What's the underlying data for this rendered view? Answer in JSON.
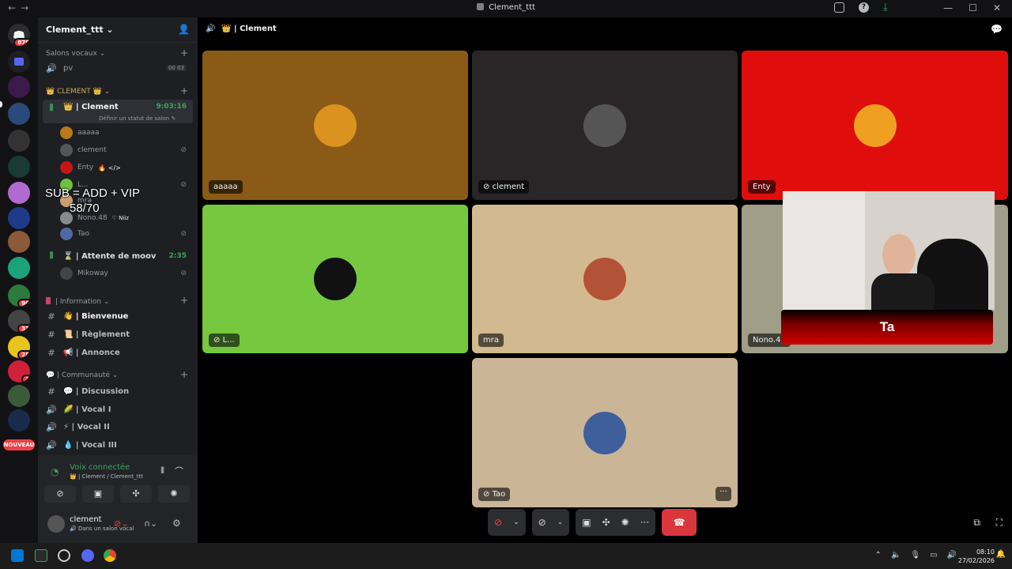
{
  "window": {
    "title": "Clement_ttt",
    "nav_back": "←",
    "nav_fwd": "→",
    "help": "?",
    "download": "⤓",
    "min": "—",
    "max": "☐",
    "close": "✕"
  },
  "rail": {
    "badges": {
      "home": "879",
      "s12": "90",
      "s13": "33",
      "s14": "28",
      "s15": "3",
      "new": "NOUVEAU"
    }
  },
  "guild": {
    "name": "Clement_ttt ⌄"
  },
  "sidebar": {
    "voice_category": "Salons vocaux ⌄",
    "pv": {
      "name": "pv",
      "counts": "00 03"
    },
    "clement_category": "👑 CLEMENT 👑 ⌄",
    "clement_channel": {
      "name": "👑 | Clement",
      "timer": "9:03:16",
      "status": "Définir un statut de salon ✎"
    },
    "users": [
      {
        "name": "aaaaa",
        "muted": false,
        "color": "#b87a1a"
      },
      {
        "name": "clement",
        "muted": true,
        "color": "#555"
      },
      {
        "name": "Enty",
        "tag": "🔥 </>",
        "muted": false,
        "color": "#c41818"
      },
      {
        "name": "L...",
        "muted": true,
        "color": "#6fbf3f"
      },
      {
        "name": "mra",
        "muted": false,
        "color": "#c8a070"
      },
      {
        "name": "Nono.48",
        "tag": "♡ Niiz",
        "muted": false,
        "color": "#8a8a8a"
      },
      {
        "name": "Tao",
        "muted": true,
        "color": "#4e6aa0"
      }
    ],
    "moov_channel": {
      "name": "⌛ | Attente de moov",
      "timer": "2:35"
    },
    "moov_user": {
      "name": "Mikoway",
      "color": "#444"
    },
    "info_category": "| Information ⌄",
    "info_channels": [
      {
        "name": "👋 | Bienvenue"
      },
      {
        "name": "📜 | Règlement"
      },
      {
        "name": "📢 | Annonce"
      }
    ],
    "comm_category": "💬 | Communauté ⌄",
    "comm_channels": [
      {
        "name": "💬 | Discussion",
        "icon": "#"
      },
      {
        "name": "🌽 | Vocal I",
        "icon": "🔊"
      },
      {
        "name": "⚡ | Vocal II",
        "icon": "🔊"
      },
      {
        "name": "💧 | Vocal III",
        "icon": "🔊"
      }
    ],
    "overlay_line1": "SUB = ADD + VIP",
    "overlay_line2": "58/70"
  },
  "voice_panel": {
    "status": "Voix connectée",
    "sub": "👑 | Clement / Clement_ttt"
  },
  "user_panel": {
    "name": "clement",
    "status": "🔊 Dans un salon vocal"
  },
  "main": {
    "title": "👑 | Clement",
    "tiles": [
      {
        "label": "aaaaa",
        "bg": "#8b5a16",
        "av": "#d9931e"
      },
      {
        "label": "clement",
        "bg": "#2a2627",
        "av": "#555"
      },
      {
        "label": "Enty",
        "bg": "#e00d0d",
        "av": "#f0a020"
      },
      {
        "label": "L...",
        "bg": "#76c93f",
        "av": "#111"
      },
      {
        "label": "mra",
        "bg": "#d3b98f",
        "av": "#b45238"
      },
      {
        "label": "Nono.48",
        "bg": "#a09e88",
        "av": "#666"
      },
      {
        "label": "Tao",
        "bg": "#cbb597",
        "av": "#3f5f9c"
      }
    ],
    "tile_more": "···",
    "cam_name": "Ta"
  },
  "controls": {
    "more": "···",
    "hangup": "☎"
  },
  "taskbar": {
    "time": "08:10",
    "date": "27/02/2026"
  }
}
